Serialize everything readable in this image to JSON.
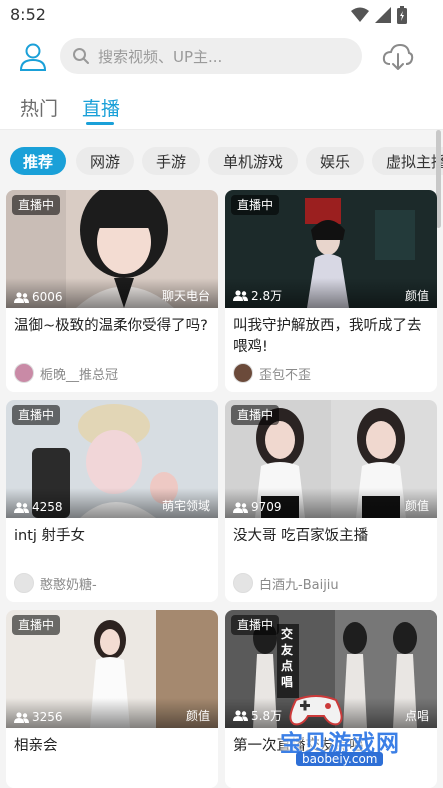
{
  "status_bar": {
    "time": "8:52"
  },
  "header": {
    "search_placeholder": "搜索视频、UP主..."
  },
  "tabs": [
    {
      "label": "热门"
    },
    {
      "label": "直播"
    }
  ],
  "categories": [
    {
      "label": "推荐"
    },
    {
      "label": "网游"
    },
    {
      "label": "手游"
    },
    {
      "label": "单机游戏"
    },
    {
      "label": "娱乐"
    },
    {
      "label": "虚拟主播"
    }
  ],
  "cards": [
    {
      "badge": "直播中",
      "viewers": "6006",
      "category": "聊天电台",
      "title": "温御~极致的温柔你受得了吗?",
      "streamer": "栀晚__推总冠"
    },
    {
      "badge": "直播中",
      "viewers": "2.8万",
      "category": "颜值",
      "title": "叫我守护解放西，我听成了去喂鸡!",
      "streamer": "歪包不歪"
    },
    {
      "badge": "直播中",
      "viewers": "4258",
      "category": "萌宅领域",
      "title": "intj 射手女",
      "streamer": "憨憨奶糖-"
    },
    {
      "badge": "直播中",
      "viewers": "9709",
      "category": "颜值",
      "title": "没大哥 吃百家饭主播",
      "streamer": "白酒九-Baijiu"
    },
    {
      "badge": "直播中",
      "viewers": "3256",
      "category": "颜值",
      "title": "相亲会",
      "streamer": ""
    },
    {
      "badge": "直播中",
      "viewers": "5.8万",
      "category": "点唱",
      "title": "第一次直播交友点唱",
      "streamer": ""
    }
  ],
  "overlay_text": {
    "sign": "交友点唱"
  },
  "watermark": {
    "title": "宝贝游戏网",
    "url": "baobeiy.com"
  },
  "colors": {
    "accent": "#1aa0d8",
    "background": "#f4f4f4"
  }
}
